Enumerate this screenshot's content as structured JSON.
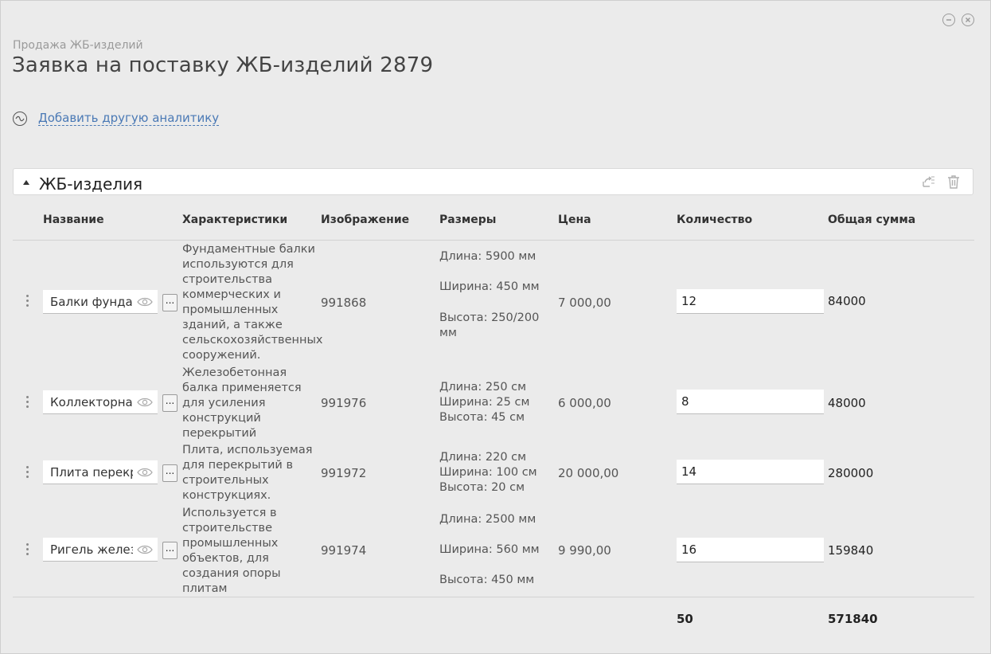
{
  "window": {
    "minimize_icon": "minus-circle-icon",
    "close_icon": "close-circle-icon"
  },
  "breadcrumb": "Продажа ЖБ-изделий",
  "title": "Заявка на поставку ЖБ-изделий 2879",
  "analytics": {
    "icon": "wave-circle-icon",
    "link_label": "Добавить другую аналитику"
  },
  "section": {
    "title": "ЖБ-изделия",
    "tools": [
      "export-icon",
      "trash-icon"
    ]
  },
  "columns": [
    "Название",
    "Характеристики",
    "Изображение",
    "Размеры",
    "Цена",
    "Количество",
    "Общая сумма"
  ],
  "rows": [
    {
      "name": "Балки фундаментные",
      "description": "Фундаментные балки используются для строительства коммерческих и промышленных зданий, а также сельскохозяйственных сооружений.",
      "image": "991868",
      "sizes": [
        "Длина: 5900 мм",
        "Ширина: 450 мм",
        "Высота: 250/200 мм"
      ],
      "price": "7 000,00",
      "quantity": "12",
      "total": "84000"
    },
    {
      "name": "Коллекторная балка",
      "description": "Железобетонная балка применяется для усиления конструкций перекрытий",
      "image": "991976",
      "sizes": [
        "Длина: 250 см",
        "Ширина: 25 см",
        "Высота: 45 см"
      ],
      "price": "6 000,00",
      "quantity": "8",
      "total": "48000"
    },
    {
      "name": "Плита перекрытия",
      "description": "Плита, используемая для перекрытий в строительных конструкциях.",
      "image": "991972",
      "sizes": [
        "Длина: 220 см",
        "Ширина: 100 см",
        "Высота: 20 см"
      ],
      "price": "20 000,00",
      "quantity": "14",
      "total": "280000"
    },
    {
      "name": "Ригель железобетонный",
      "description": "Используется в строительстве промышленных объектов, для создания опоры плитам",
      "image": "991974",
      "sizes": [
        "Длина: 2500 мм",
        "Ширина: 560 мм",
        "Высота: 450 мм"
      ],
      "price": "9 990,00",
      "quantity": "16",
      "total": "159840"
    }
  ],
  "footer": {
    "quantity_total": "50",
    "sum_total": "571840"
  },
  "dots_label": "..."
}
